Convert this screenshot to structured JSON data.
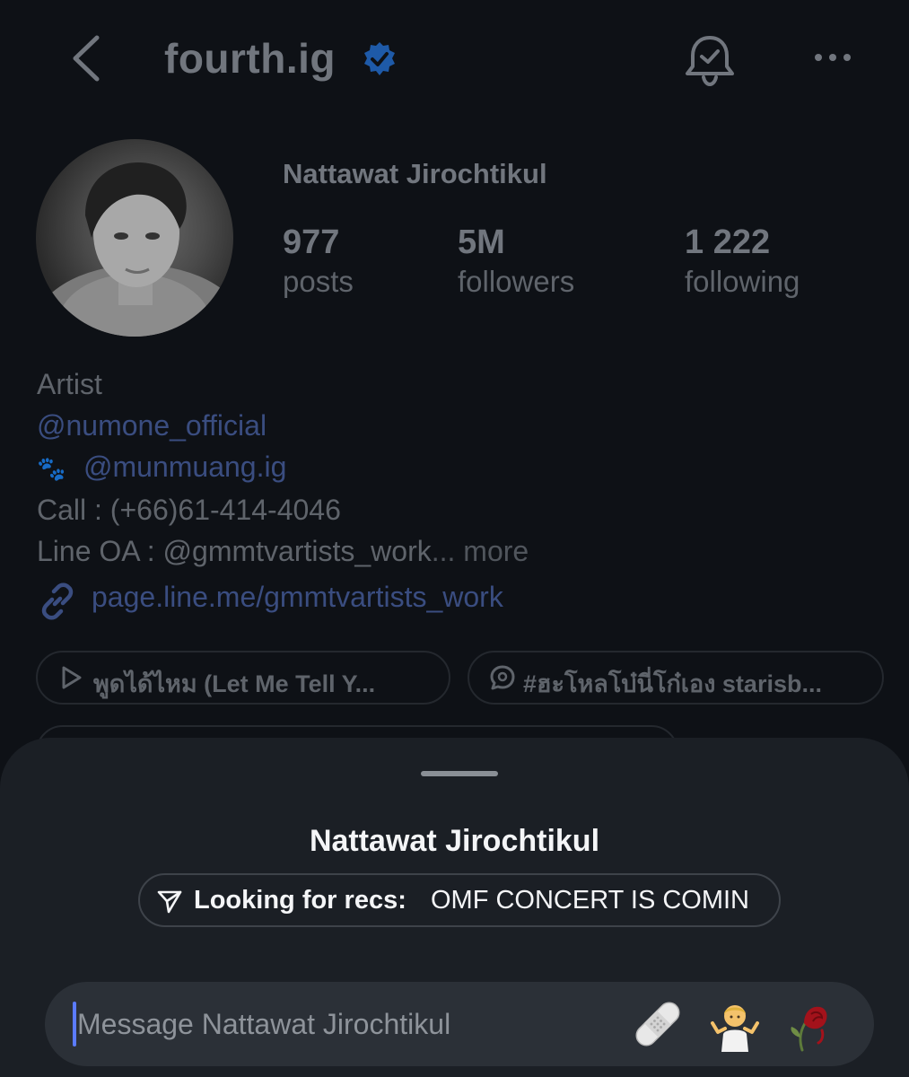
{
  "header": {
    "username": "fourth.ig",
    "back_icon": "chevron-left-icon",
    "verified_icon": "verified-badge-icon",
    "bell_icon": "bell-check-icon",
    "more_icon": "more-horizontal-icon"
  },
  "profile": {
    "display_name": "Nattawat Jirochtikul",
    "stats": {
      "posts": {
        "value": "977",
        "label": "posts"
      },
      "followers": {
        "value": "5M",
        "label": "followers"
      },
      "following": {
        "value": "1 222",
        "label": "following"
      }
    },
    "bio": {
      "category": "Artist",
      "mention1": "@numone_official",
      "paw_glyph": "🐾",
      "mention2": "@munmuang.ig",
      "call": "Call : (+66)61-414-4046",
      "line": "Line OA : @gmmtvartists_work",
      "ellipsis": "...",
      "more": "more"
    },
    "link": "page.line.me/gmmtvartists_work",
    "chips": {
      "song": "พูดได้ไหม (Let Me Tell Y...",
      "thread": "#ฮะโหลโบ๋นี่โก๋เอง starisb..."
    }
  },
  "sheet": {
    "name": "Nattawat Jirochtikul",
    "recs_label": "Looking for recs:",
    "recs_value": "OMF CONCERT IS COMIN",
    "message_placeholder": "Message Nattawat Jirochtikul",
    "emojis": {
      "bandage": "adhesive-bandage-emoji",
      "shrug": "person-shrugging-emoji",
      "rose": "wilted-rose-emoji"
    }
  },
  "colors": {
    "background": "#0e1116",
    "sheet": "#1b1f25",
    "input": "#2b3037",
    "caret": "#5b7bff",
    "dim_link": "#3a4d80",
    "verified": "#1e5aa8"
  }
}
